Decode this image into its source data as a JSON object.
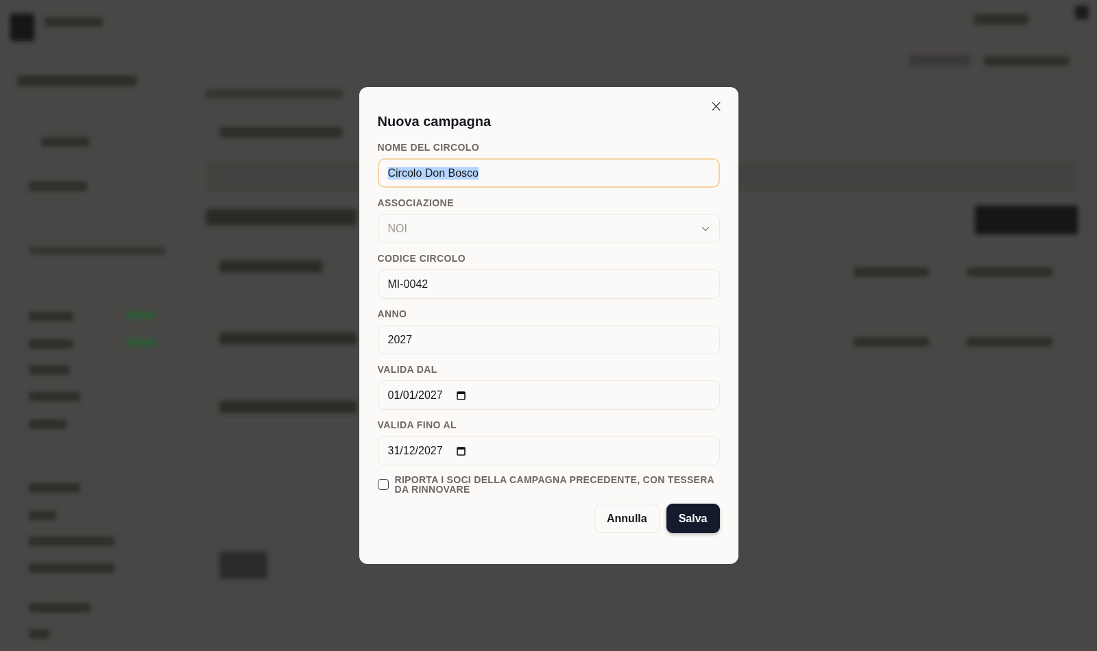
{
  "dialog": {
    "title": "Nuova campagna",
    "close_icon": "×",
    "fields": [
      {
        "kind": "text",
        "label": "NOME DEL CIRCOLO",
        "value": "Circolo Don Bosco",
        "focused": true,
        "disabled": false
      },
      {
        "kind": "select",
        "label": "ASSOCIAZIONE",
        "value": "NOI",
        "focused": false,
        "disabled": true
      },
      {
        "kind": "text",
        "label": "CODICE CIRCOLO",
        "value": "MI-0042",
        "focused": false,
        "disabled": false
      },
      {
        "kind": "text",
        "label": "ANNO",
        "value": "2027",
        "focused": false,
        "disabled": false
      },
      {
        "kind": "date",
        "label": "VALIDA DAL",
        "value": "01/01/2027",
        "focused": false,
        "disabled": false
      },
      {
        "kind": "date",
        "label": "VALIDA FINO AL",
        "value": "31/12/2027",
        "focused": false,
        "disabled": false
      }
    ],
    "checkbox": {
      "label": "RIPORTA I SOCI DELLA CAMPAGNA PRECEDENTE, CON TESSERA DA RINNOVARE",
      "checked": false
    },
    "buttons": [
      {
        "kind": "secondary",
        "label": "Annulla"
      },
      {
        "kind": "primary",
        "label": "Salva"
      }
    ]
  }
}
